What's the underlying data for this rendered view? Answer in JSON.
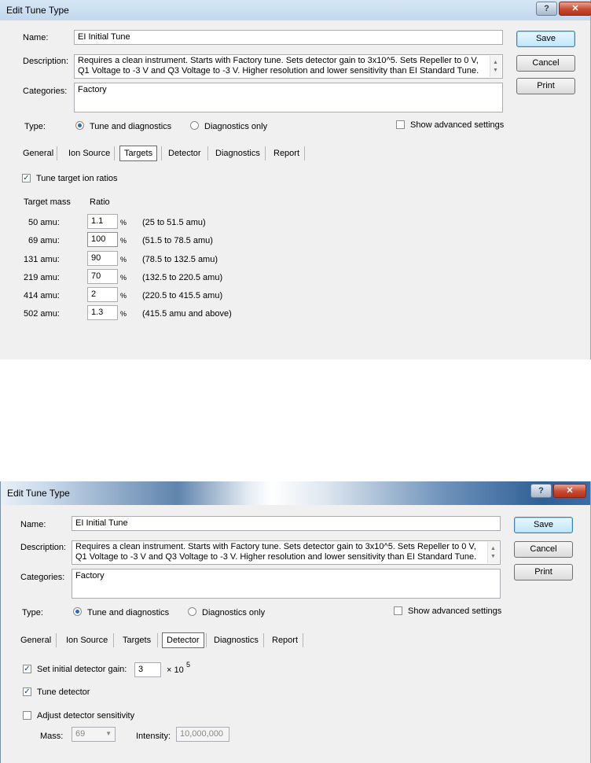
{
  "dialog1": {
    "title": "Edit Tune Type",
    "help_label": "?",
    "close_label": "✕",
    "name_label": "Name:",
    "name_value": "EI Initial Tune",
    "description_label": "Description:",
    "description_value": "Requires a clean instrument. Starts with Factory tune. Sets detector gain to 3x10^5. Sets Repeller to 0 V, Q1 Voltage to -3 V and Q3 Voltage to -3 V. Higher resolution and lower sensitivity than EI Standard Tune.",
    "categories_label": "Categories:",
    "categories_value": "Factory",
    "save_label": "Save",
    "cancel_label": "Cancel",
    "print_label": "Print",
    "type_label": "Type:",
    "radio_tune": "Tune and diagnostics",
    "radio_diag": "Diagnostics only",
    "advanced_label": "Show advanced settings",
    "tabs": [
      "General",
      "Ion Source",
      "Targets",
      "Detector",
      "Diagnostics",
      "Report"
    ],
    "selected_tab": "Targets",
    "tune_ratios_label": "Tune target ion ratios",
    "col_mass": "Target mass",
    "col_ratio": "Ratio",
    "pct_symbol": "%",
    "rows": [
      {
        "mass": "50 amu:",
        "ratio": "1.1",
        "range": "(25 to 51.5 amu)"
      },
      {
        "mass": "69 amu:",
        "ratio": "100",
        "range": "(51.5 to 78.5 amu)"
      },
      {
        "mass": "131 amu:",
        "ratio": "90",
        "range": "(78.5 to 132.5 amu)"
      },
      {
        "mass": "219 amu:",
        "ratio": "70",
        "range": "(132.5 to 220.5 amu)"
      },
      {
        "mass": "414 amu:",
        "ratio": "2",
        "range": "(220.5 to 415.5 amu)"
      },
      {
        "mass": "502 amu:",
        "ratio": "1.3",
        "range": "(415.5 amu and above)"
      }
    ]
  },
  "dialog2": {
    "title": "Edit Tune Type",
    "help_label": "?",
    "close_label": "✕",
    "name_label": "Name:",
    "name_value": "EI Initial Tune",
    "description_label": "Description:",
    "description_value": "Requires a clean instrument. Starts with Factory tune. Sets detector gain to 3x10^5. Sets Repeller to 0 V, Q1 Voltage to -3 V and Q3 Voltage to -3 V. Higher resolution and lower sensitivity than EI Standard Tune.",
    "categories_label": "Categories:",
    "categories_value": "Factory",
    "save_label": "Save",
    "cancel_label": "Cancel",
    "print_label": "Print",
    "type_label": "Type:",
    "radio_tune": "Tune and diagnostics",
    "radio_diag": "Diagnostics only",
    "advanced_label": "Show advanced settings",
    "tabs": [
      "General",
      "Ion Source",
      "Targets",
      "Detector",
      "Diagnostics",
      "Report"
    ],
    "selected_tab": "Detector",
    "gain_label": "Set initial detector gain:",
    "gain_value": "3",
    "gain_multiplier": "× 10",
    "gain_exponent": "5",
    "tune_detector_label": "Tune detector",
    "adjust_label": "Adjust detector sensitivity",
    "mass_label": "Mass:",
    "mass_value": "69",
    "intensity_label": "Intensity:",
    "intensity_value": "10,000,000"
  },
  "check_glyph": "✓",
  "scroll_up": "▲",
  "scroll_down": "▼",
  "combo_arrow": "▼"
}
